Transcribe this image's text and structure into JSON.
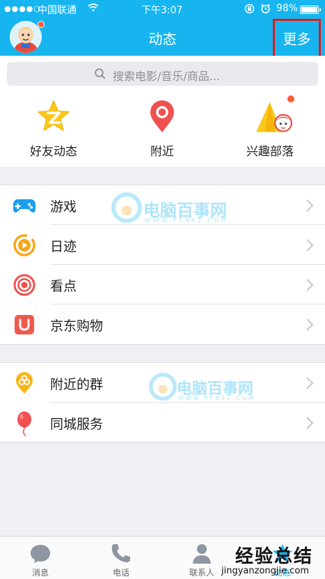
{
  "status_bar": {
    "signal": "●●●●○",
    "carrier": "中国联通",
    "time": "下午3:07",
    "battery_pct": "98%",
    "battery_level": 0.98
  },
  "nav": {
    "title": "动态",
    "more_label": "更多"
  },
  "search": {
    "placeholder": "搜索电影/音乐/商品..."
  },
  "quick_actions": [
    {
      "label": "好友动态",
      "icon": "qzone-star-icon"
    },
    {
      "label": "附近",
      "icon": "location-pin-icon"
    },
    {
      "label": "兴趣部落",
      "icon": "tribe-tent-icon"
    }
  ],
  "group1": [
    {
      "label": "游戏",
      "icon": "gamepad-icon"
    },
    {
      "label": "日迹",
      "icon": "play-circle-icon"
    },
    {
      "label": "看点",
      "icon": "eye-icon"
    },
    {
      "label": "京东购物",
      "icon": "shopping-bag-icon"
    }
  ],
  "group2": [
    {
      "label": "附近的群",
      "icon": "nearby-group-icon"
    },
    {
      "label": "同城服务",
      "icon": "balloon-icon"
    }
  ],
  "watermark": {
    "brand": "电脑百事网",
    "url": "WWW.PC841.COM"
  },
  "tabs": [
    {
      "label": "消息",
      "icon": "message-bubble-icon"
    },
    {
      "label": "电话",
      "icon": "phone-icon"
    },
    {
      "label": "联系人",
      "icon": "contact-person-icon"
    },
    {
      "label": "动态",
      "icon": "star-icon"
    }
  ],
  "corner_watermark": {
    "title": "经验总结",
    "url": "jingyanzongjie.com"
  },
  "colors": {
    "accent": "#16b5f0",
    "highlight_box": "#e21a1a",
    "badge": "#ff5b3a"
  }
}
